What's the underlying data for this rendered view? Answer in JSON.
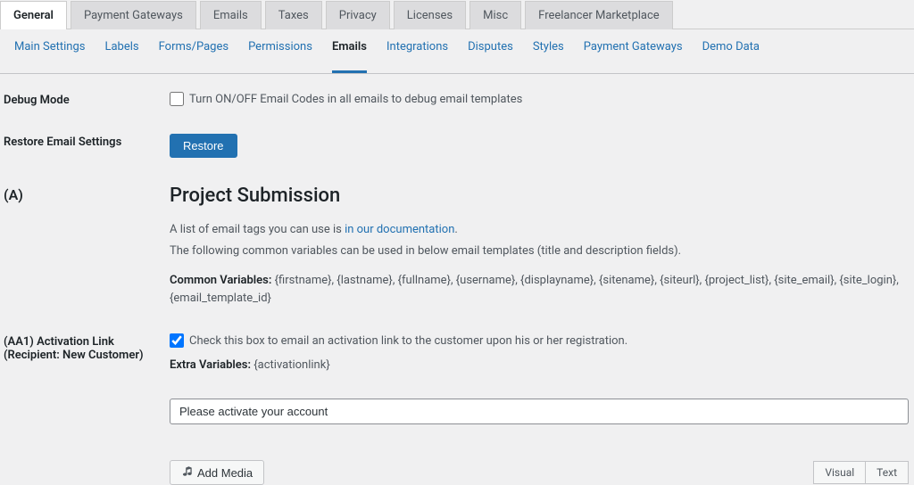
{
  "topTabs": [
    {
      "label": "General",
      "active": true
    },
    {
      "label": "Payment Gateways"
    },
    {
      "label": "Emails"
    },
    {
      "label": "Taxes"
    },
    {
      "label": "Privacy"
    },
    {
      "label": "Licenses"
    },
    {
      "label": "Misc"
    },
    {
      "label": "Freelancer Marketplace"
    }
  ],
  "subTabs": [
    {
      "label": "Main Settings"
    },
    {
      "label": "Labels"
    },
    {
      "label": "Forms/Pages"
    },
    {
      "label": "Permissions"
    },
    {
      "label": "Emails",
      "active": true
    },
    {
      "label": "Integrations"
    },
    {
      "label": "Disputes"
    },
    {
      "label": "Styles"
    },
    {
      "label": "Payment Gateways"
    },
    {
      "label": "Demo Data"
    }
  ],
  "debugMode": {
    "label": "Debug Mode",
    "checkboxLabel": "Turn ON/OFF Email Codes in all emails to debug email templates"
  },
  "restore": {
    "label": "Restore Email Settings",
    "buttonLabel": "Restore"
  },
  "sectionA": {
    "marker": "(A)",
    "title": "Project Submission",
    "descPrefix": "A list of email tags you can use is ",
    "docLink": "in our documentation",
    "descPeriod": ".",
    "descLine2": "The following common variables can be used in below email templates (title and description fields).",
    "commonVarsLabel": "Common Variables:",
    "commonVars": " {firstname}, {lastname}, {fullname}, {username}, {displayname}, {sitename}, {siteurl}, {project_list}, {site_email}, {site_login}, {email_template_id}"
  },
  "aa1": {
    "labelLine1": "(AA1) Activation Link",
    "labelLine2": "(Recipient: New Customer)",
    "checkboxLabel": "Check this box to email an activation link to the customer upon his or her registration.",
    "extraVarsLabel": "Extra Variables:",
    "extraVars": " {activationlink}",
    "titleInput": "Please activate your account"
  },
  "editor": {
    "addMedia": "Add Media",
    "visualTab": "Visual",
    "textTab": "Text"
  }
}
